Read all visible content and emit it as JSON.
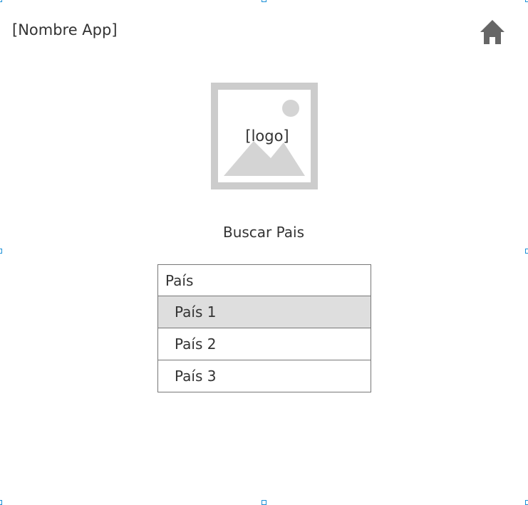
{
  "header": {
    "app_name": "[Nombre App]",
    "home_icon": "home-icon"
  },
  "logo": {
    "label": "[logo]",
    "icon": "image-placeholder-icon"
  },
  "search": {
    "title": "Buscar Pais",
    "placeholder": "País",
    "value": "",
    "options": [
      {
        "label": "País 1",
        "selected": true
      },
      {
        "label": "País 2",
        "selected": false
      },
      {
        "label": "País 3",
        "selected": false
      }
    ]
  },
  "colors": {
    "text": "#333333",
    "border": "#777777",
    "selected_bg": "#dedede",
    "placeholder_gray": "#cccccc",
    "icon_gray": "#666666",
    "selection_handle": "#1a8fd6"
  }
}
